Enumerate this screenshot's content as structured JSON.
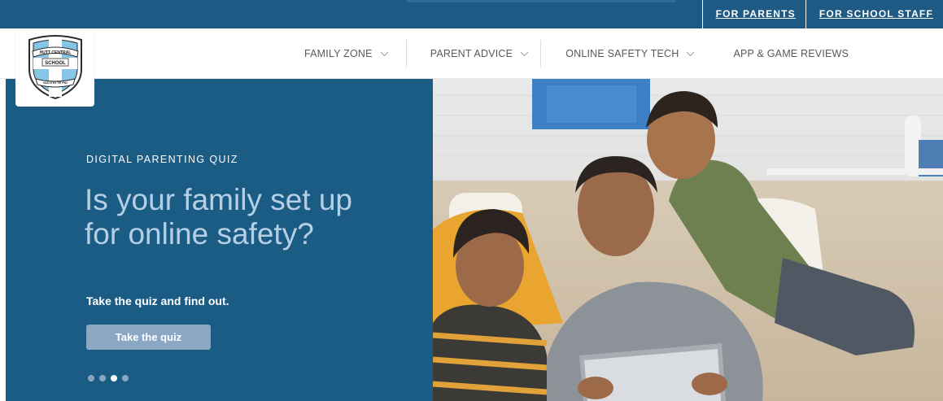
{
  "topbar": {
    "links": [
      {
        "label": "FOR PARENTS"
      },
      {
        "label": "FOR SCHOOL STAFF"
      }
    ]
  },
  "logo": {
    "text_top": "HUTT CENTRAL",
    "text_mid": "SCHOOL",
    "text_bottom": "KIA U KI TE PAI"
  },
  "nav": {
    "items": [
      {
        "label": "FAMILY ZONE",
        "has_dropdown": true
      },
      {
        "label": "PARENT ADVICE",
        "has_dropdown": true
      },
      {
        "label": "ONLINE SAFETY TECH",
        "has_dropdown": true
      },
      {
        "label": "APP & GAME REVIEWS",
        "has_dropdown": false
      }
    ]
  },
  "hero": {
    "eyebrow": "DIGITAL PARENTING QUIZ",
    "headline": "Is your family set up for online safety?",
    "subline": "Take the quiz and find out.",
    "cta_label": "Take the quiz",
    "slides_total": 4,
    "active_slide": 3,
    "image_icon": "family-tablet-photo"
  },
  "colors": {
    "brand_blue": "#1b5c85",
    "topbar_blue": "#1f5a85",
    "headline": "#b7cfe4",
    "cta_bg": "#8aa8c4",
    "nav_text": "#555a60"
  }
}
